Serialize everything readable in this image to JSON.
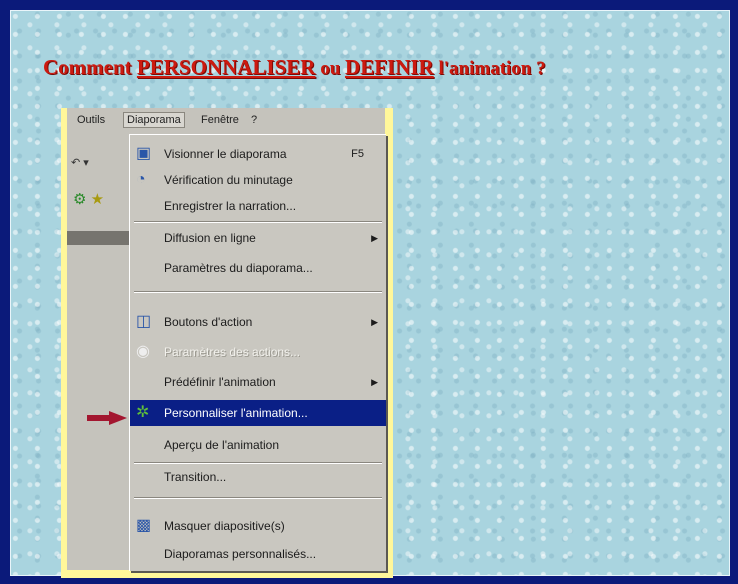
{
  "title": {
    "part1": "Comment ",
    "part2": "PERSONNALISER",
    "part3": " ou ",
    "part4": "DEFINIR",
    "part5": " l'animation ?"
  },
  "menubar": {
    "outils": "Outils",
    "diaporama": "Diaporama",
    "fenetre": "Fenêtre",
    "help": "?"
  },
  "menu": {
    "items": [
      {
        "label": "Visionner le diaporama",
        "shortcut": "F5",
        "icon": "slideshow-icon"
      },
      {
        "label": "Vérification du minutage",
        "icon": "timer-icon"
      },
      {
        "label": "Enregistrer la narration..."
      },
      {
        "label": "Diffusion en ligne",
        "submenu": true
      },
      {
        "label": "Paramètres du diaporama..."
      },
      {
        "label": "Boutons d'action",
        "submenu": true,
        "icon": "action-buttons-icon"
      },
      {
        "label": "Paramètres des actions...",
        "disabled": true,
        "icon": "action-settings-icon"
      },
      {
        "label": "Prédéfinir l'animation",
        "submenu": true
      },
      {
        "label": "Personnaliser l'animation...",
        "highlight": true,
        "icon": "custom-animation-icon"
      },
      {
        "label": "Aperçu de l'animation"
      },
      {
        "label": "Transition..."
      },
      {
        "label": "Masquer diapositive(s)",
        "icon": "hide-slide-icon"
      },
      {
        "label": "Diaporamas personnalisés..."
      }
    ]
  },
  "colors": {
    "title": "#cc1a10",
    "highlight": "#0a1f86",
    "pointer": "#a3162f",
    "background": "#a9d4df"
  }
}
